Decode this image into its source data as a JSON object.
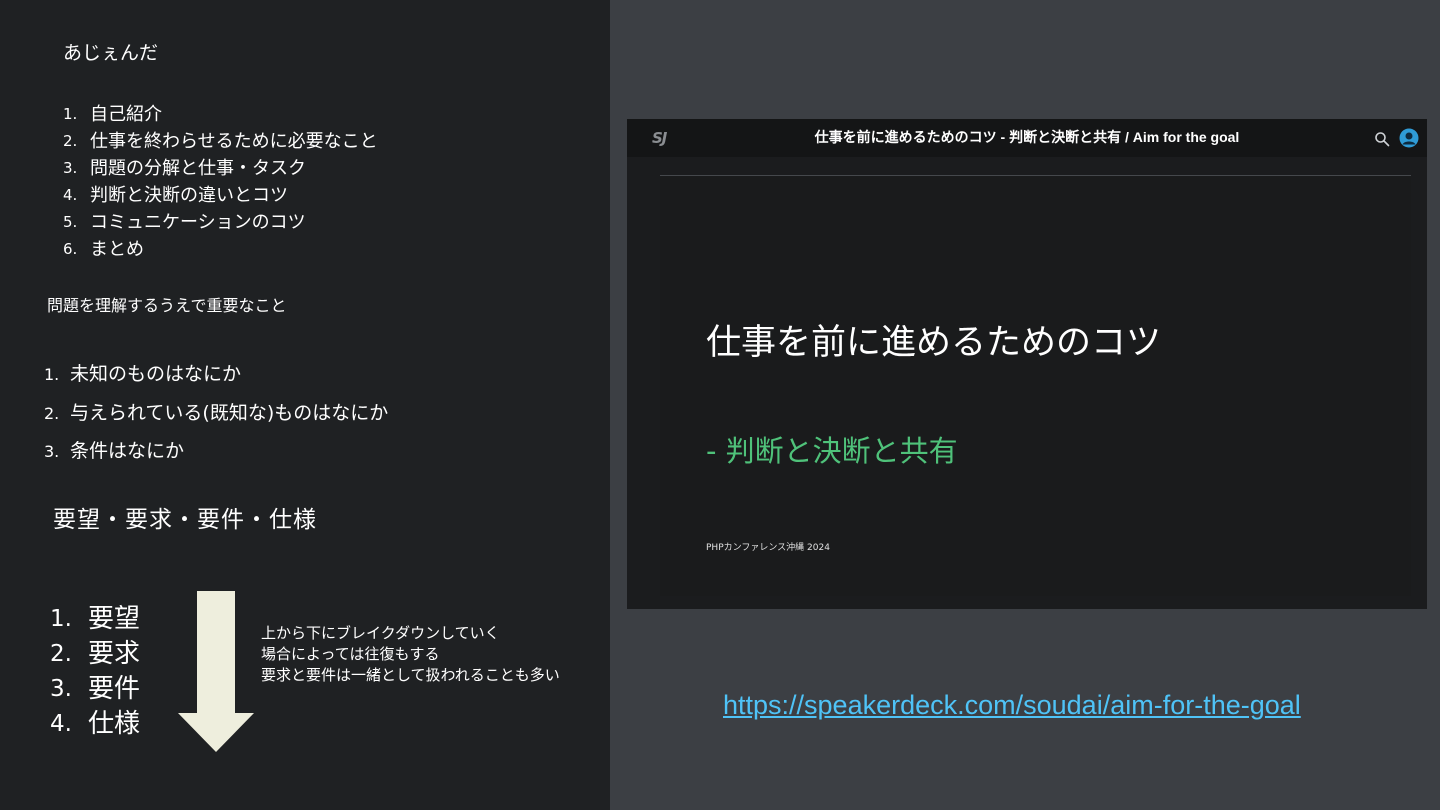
{
  "left": {
    "agenda_title": "あじぇんだ",
    "agenda": [
      {
        "num": "1.",
        "label": "自己紹介"
      },
      {
        "num": "2.",
        "label": "仕事を終わらせるために必要なこと"
      },
      {
        "num": "3.",
        "label": "問題の分解と仕事・タスク"
      },
      {
        "num": "4.",
        "label": "判断と決断の違いとコツ"
      },
      {
        "num": "5.",
        "label": "コミュニケーションのコツ"
      },
      {
        "num": "6.",
        "label": "まとめ"
      }
    ],
    "section_title": "問題を理解するうえで重要なこと",
    "questions": [
      {
        "num": "1.",
        "label": "未知のものはなにか"
      },
      {
        "num": "2.",
        "label": "与えられている(既知な)ものはなにか"
      },
      {
        "num": "3.",
        "label": "条件はなにか"
      }
    ],
    "req_title": "要望・要求・要件・仕様",
    "req_list": [
      {
        "num": "1.",
        "label": "要望"
      },
      {
        "num": "2.",
        "label": "要求"
      },
      {
        "num": "3.",
        "label": "要件"
      },
      {
        "num": "4.",
        "label": "仕様"
      }
    ],
    "note_lines": [
      "上から下にブレイクダウンしていく",
      "場合によっては往復もする",
      "要求と要件は一緒として扱われることも多い"
    ]
  },
  "viewer": {
    "logo": "SJ",
    "title": "仕事を前に進めるためのコツ - 判断と決断と共有 / Aim for the goal",
    "slide_title": "仕事を前に進めるためのコツ",
    "slide_subtitle": "- 判断と決断と共有",
    "slide_footer": "PHPカンファレンス沖縄 2024",
    "icons": [
      "search-icon",
      "user-avatar-icon"
    ]
  },
  "link": "https://speakerdeck.com/soudai/aim-for-the-goal",
  "colors": {
    "background": "#3c3f44",
    "left_panel": "#1f2123",
    "accent_green": "#4fc27a",
    "link_blue": "#4fc3f7",
    "arrow": "#eeeedd"
  }
}
